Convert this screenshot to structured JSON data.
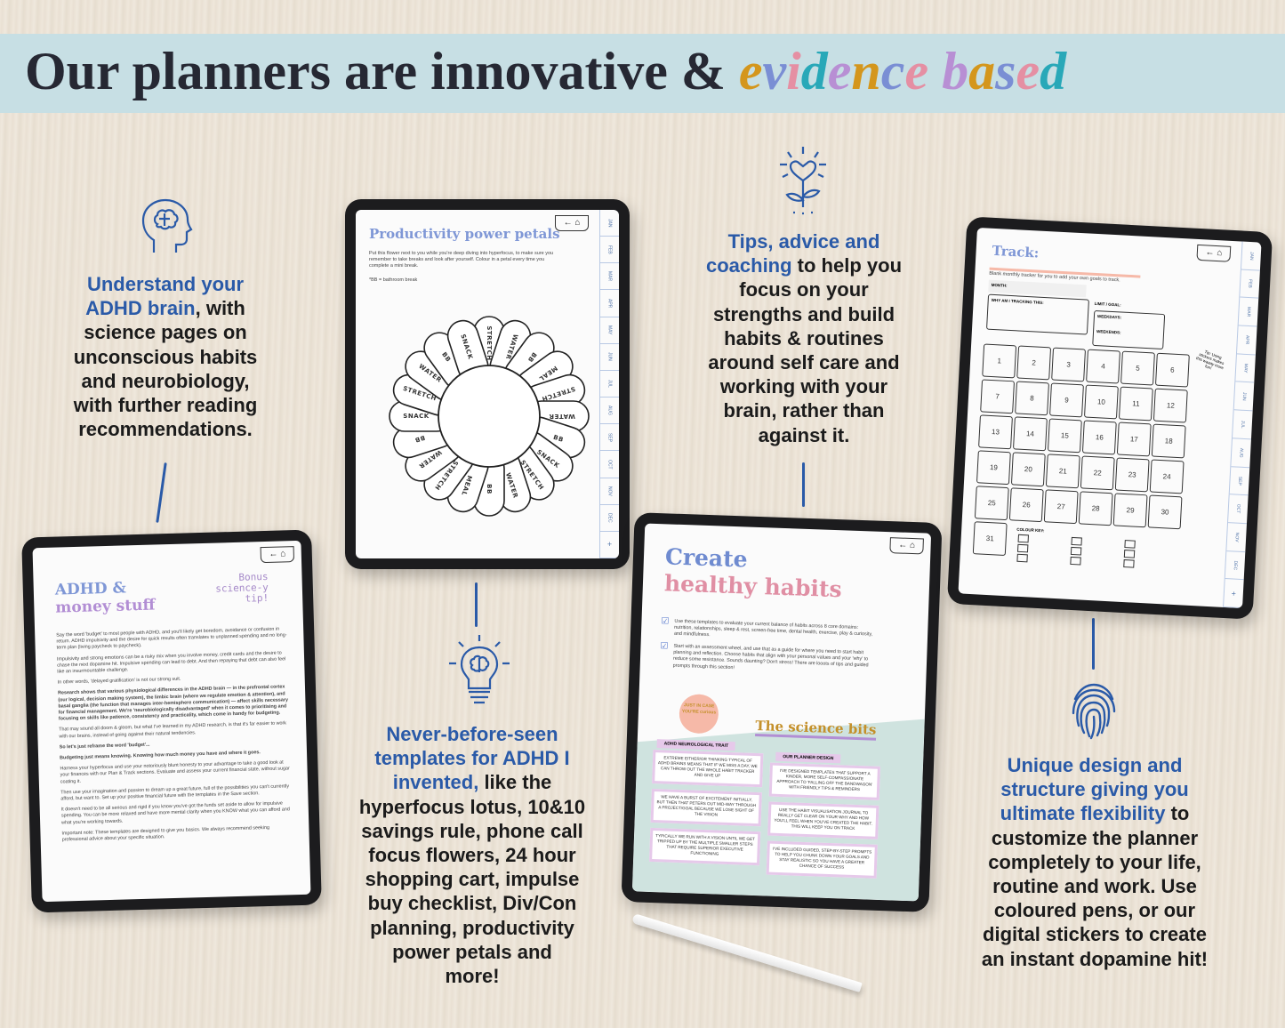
{
  "header": {
    "title_main": "Our planners are innovative & ",
    "title_highlight": "evidence based",
    "highlight_colors": [
      "#d4961c",
      "#7a8ed4",
      "#e58fa3",
      "#28a8b8",
      "#b88fd4"
    ]
  },
  "colors": {
    "accent_blue": "#2a5aa8",
    "banner": "#c7dfe4",
    "peach": "#f6b9a8",
    "mint": "#cfe3df",
    "lilac": "#e6c9ea"
  },
  "features": [
    {
      "icon": "brain-head-icon",
      "lines": [
        [
          "Understand your",
          ""
        ],
        [
          "ADHD brain",
          ", with"
        ],
        [
          "",
          "science pages on"
        ],
        [
          "",
          "unconscious habits"
        ],
        [
          "",
          "and neurobiology,"
        ],
        [
          "",
          "with further reading"
        ],
        [
          "",
          "recommendations."
        ]
      ]
    },
    {
      "icon": "flower-heart-icon",
      "lines": [
        [
          "Tips, advice and",
          ""
        ],
        [
          "coaching",
          " to help you"
        ],
        [
          "",
          "focus on your"
        ],
        [
          "",
          "strengths and build"
        ],
        [
          "",
          "habits & routines"
        ],
        [
          "",
          "around self care and"
        ],
        [
          "",
          "working with your"
        ],
        [
          "",
          "brain, rather than"
        ],
        [
          "",
          "against it."
        ]
      ]
    },
    {
      "icon": "lightbulb-brain-icon",
      "lines": [
        [
          "Never-before-seen",
          ""
        ],
        [
          "templates for ADHD I",
          ""
        ],
        [
          "invented,",
          " like the"
        ],
        [
          "",
          "hyperfocus lotus, 10&10"
        ],
        [
          "",
          "savings rule, phone call"
        ],
        [
          "",
          "focus flowers, 24 hour"
        ],
        [
          "",
          "shopping cart, impulse"
        ],
        [
          "",
          "buy checklist, Div/Con"
        ],
        [
          "",
          "planning, productivity"
        ],
        [
          "",
          "power petals and"
        ],
        [
          "",
          "more!"
        ]
      ]
    },
    {
      "icon": "fingerprint-icon",
      "lines": [
        [
          "Unique design and",
          ""
        ],
        [
          "structure giving you",
          ""
        ],
        [
          "ultimate flexibility",
          " to"
        ],
        [
          "",
          "customize the planner"
        ],
        [
          "",
          "completely to your life,"
        ],
        [
          "",
          "routine and work. Use"
        ],
        [
          "",
          "coloured pens, or our"
        ],
        [
          "",
          "digital stickers to create"
        ],
        [
          "",
          "an instant dopamine hit!"
        ]
      ]
    }
  ],
  "nav": {
    "back": "←",
    "home": "⌂",
    "add": "+"
  },
  "months": [
    "JAN",
    "FEB",
    "MAR",
    "APR",
    "MAY",
    "JUN",
    "JUL",
    "AUG",
    "SEP",
    "OCT",
    "NOV",
    "DEC"
  ],
  "money": {
    "title1": "ADHD &",
    "title2": "money stuff",
    "tip": "Bonus science-y tip!",
    "paragraphs": [
      "Say the word 'budget' to most people with ADHD, and you'll likely get boredom, avoidance or confusion in return. ADHD impulsivity and the desire for quick results often translates to unplanned spending and no long-term plan (living paycheck to paycheck).",
      "Impulsivity and strong emotions can be a risky mix when you involve money, credit cards and the desire to chase the next dopamine hit. Impulsive spending can lead to debt. And then repaying that debt can also feel like an insurmountable challenge.",
      "In other words, 'delayed gratification' is not our strong suit.",
      "Research shows that various physiological differences in the ADHD brain — in the prefrontal cortex (our logical, decision making system), the limbic brain (where we regulate emotion & attention), and basal ganglia (the function that manages inter-hemisphere communication) — affect skills necessary for financial management. We're 'neurobiologically disadvantaged' when it comes to prioritising and focusing on skills like patience, consistency and practicality, which come in handy for budgeting.",
      "That may sound all doom & gloom, but what I've learned in my ADHD research, is that it's far easier to work with our brains, instead of going against their natural tendencies.",
      "So let's just reframe the word 'budget'...",
      "Budgeting just means knowing. Knowing how much money you have and where it goes.",
      "Harness your hyperfocus and use your notoriously blunt honesty to your advantage to take a good look at your finances with our Plan & Track sections. Evaluate and assess your current financial state, without sugar coating it.",
      "Then use your imagination and passion to dream up a great future, full of the possibilities you can't currently afford, but want to. Set up your positive financial future with the templates in the Save section.",
      "It doesn't need to be all serious and rigid if you know you've got the funds set aside to allow for impulsive spending. You can be more relaxed and have more mental clarity when you KNOW what you can afford and what you're working towards.",
      "Important note: These templates are designed to give you basics. We always recommend seeking professional advice about your specific situation."
    ]
  },
  "petals": {
    "title": "Productivity power petals",
    "intro": "Put this flower next to you while you're deep diving into hyperfocus, to make sure you remember to take breaks and look after yourself. Colour in a petal every time you complete a mini break.",
    "note": "*BB = bathroom break",
    "labels": [
      "STRETCH",
      "WATER",
      "BB",
      "MEAL",
      "STRETCH",
      "WATER",
      "BB",
      "SNACK",
      "STRETCH",
      "WATER",
      "BB",
      "MEAL",
      "STRETCH",
      "WATER",
      "BB",
      "SNACK",
      "STRETCH",
      "WATER",
      "BB",
      "SNACK"
    ]
  },
  "habits": {
    "title1": "Create",
    "title2": "healthy habits",
    "check1": "Use these templates to evaluate your current balance of habits across 8 core domains: nutrition, relationships, sleep & rest, screen-free time, dental health, exercise, play & curiosity, and mindfulness.",
    "check2": "Start with an assessment wheel, and use that as a guide for where you need to start habit planning and reflection. Choose habits that align with your personal values and your 'why' to reduce some resistance. Sounds daunting? Don't stress! There are looots of tips and guided prompts through this section!",
    "badge": "JUST IN CASE YOU'RE curious",
    "science_title": "The science bits",
    "col1": "ADHD NEUROLOGICAL TRAIT",
    "col2": "OUR PLANNER DESIGN",
    "traits": [
      "Extreme either/or thinking typical of ADHD brains means that if we miss a day, we can throw out the whole habit tracker and give up",
      "We have a burst of excitement initially, but then that peters out mid-way through a project/goal because we lose sight of the vision",
      "Typically we run with a vision until we get tripped up by the multiple smaller steps that require superior executive functioning"
    ],
    "designs": [
      "I've designed templates that support a kinder, more self-compassionate approach to 'falling off the bandwagon' with friendly tips & reminders",
      "Use the habit visualisation journal to really get clear on your why and how you'll feel when you've created the habit. This will keep you on track",
      "I've included guided, step-by-step prompts to help you chunk down your goals and stay realistic so you have a greater chance of success"
    ]
  },
  "track": {
    "title": "Track:",
    "subtitle": "Blank monthly tracker for you to add your own goals to track.",
    "month": "MONTH:",
    "why": "WHY AM I TRACKING THIS:",
    "limit": "LIMIT / GOAL:",
    "weekdays": "WEEKDAYS:",
    "weekends": "WEEKENDS:",
    "tip": "Tip: Using stickers makes this waaay more fun!",
    "colour_key": "COLOUR KEY:",
    "days": [
      "1",
      "2",
      "3",
      "4",
      "5",
      "6",
      "7",
      "8",
      "9",
      "10",
      "11",
      "12",
      "13",
      "14",
      "15",
      "16",
      "17",
      "18",
      "19",
      "20",
      "21",
      "22",
      "23",
      "24",
      "25",
      "26",
      "27",
      "28",
      "29",
      "30",
      "31"
    ]
  }
}
